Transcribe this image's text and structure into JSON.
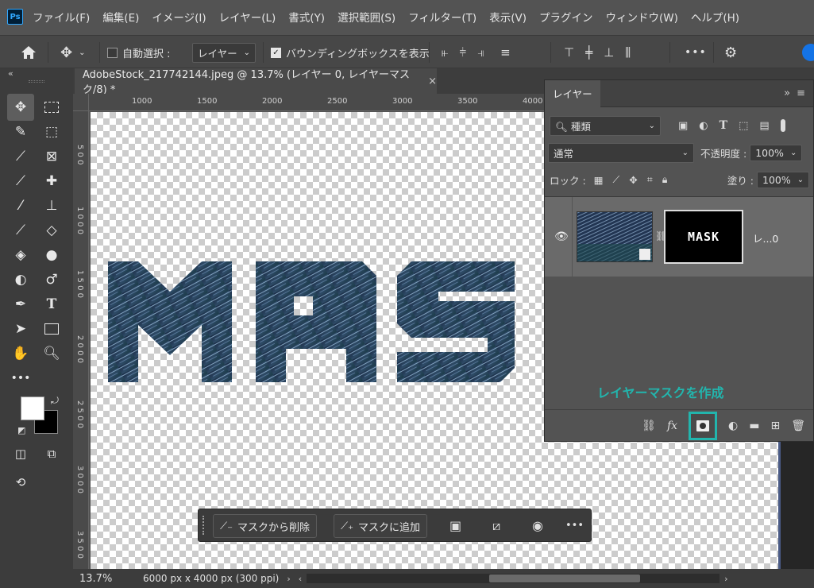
{
  "menubar": {
    "logo": "Ps",
    "items": [
      "ファイル(F)",
      "編集(E)",
      "イメージ(I)",
      "レイヤー(L)",
      "書式(Y)",
      "選択範囲(S)",
      "フィルター(T)",
      "表示(V)",
      "プラグイン",
      "ウィンドウ(W)",
      "ヘルプ(H)"
    ]
  },
  "options": {
    "auto_select_label": "自動選択 :",
    "auto_select_target": "レイヤー",
    "bounding_box_label": "バウンディングボックスを表示",
    "more": "•••"
  },
  "document": {
    "tab_title": "AdobeStock_217742144.jpeg @ 13.7% (レイヤー 0, レイヤーマスク/8) *",
    "close": "×"
  },
  "rulers": {
    "top": [
      "1000",
      "1500",
      "2000",
      "2500",
      "3000",
      "3500",
      "4000"
    ],
    "left": [
      "5 0 0",
      "1 0 0 0",
      "1 5 0 0",
      "2 0 0 0",
      "2 5 0 0",
      "3 0 0 0",
      "3 5 0 0"
    ]
  },
  "canvas": {
    "text_art": "MAS"
  },
  "layers_panel": {
    "tab": "レイヤー",
    "filter_kind": "種類",
    "blend_mode": "通常",
    "opacity_label": "不透明度 :",
    "opacity_value": "100%",
    "lock_label": "ロック :",
    "fill_label": "塗り :",
    "fill_value": "100%",
    "layer_name": "レ...0",
    "mask_text": "MASK"
  },
  "annotation": {
    "label": "レイヤーマスクを作成",
    "color": "#20b2aa"
  },
  "floatbar": {
    "remove_label": "マスクから削除",
    "add_label": "マスクに追加",
    "more": "•••"
  },
  "status": {
    "zoom": "13.7%",
    "doc_info": "6000 px x 4000 px (300 ppi)"
  }
}
